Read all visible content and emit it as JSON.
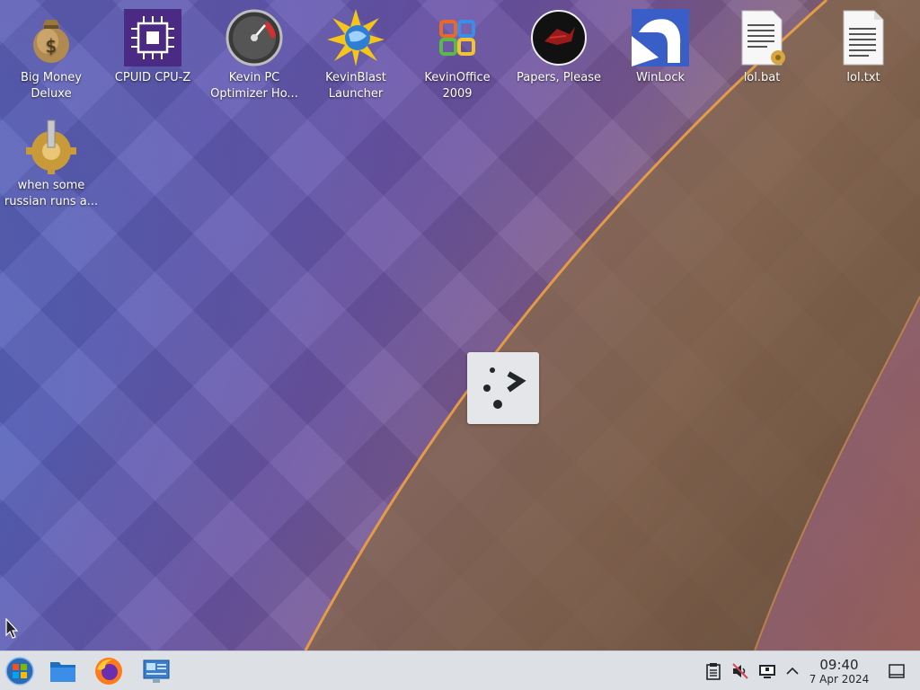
{
  "desktop": {
    "icons": [
      {
        "label": "Big Money Deluxe",
        "icon": "money-bag-icon"
      },
      {
        "label": "CPUID CPU-Z",
        "icon": "cpu-chip-icon"
      },
      {
        "label": "Kevin PC Optimizer Ho...",
        "icon": "speedometer-icon"
      },
      {
        "label": "KevinBlast Launcher",
        "icon": "starburst-globe-icon"
      },
      {
        "label": "KevinOffice 2009",
        "icon": "office-logo-icon"
      },
      {
        "label": "Papers, Please",
        "icon": "papers-please-icon"
      },
      {
        "label": "WinLock",
        "icon": "winlock-icon"
      },
      {
        "label": "lol.bat",
        "icon": "batch-file-icon"
      },
      {
        "label": "lol.txt",
        "icon": "text-file-icon"
      },
      {
        "label": "when some russian runs a...",
        "icon": "gear-joystick-icon"
      }
    ]
  },
  "busy_indicator": {
    "icon": "launch-feedback-icon"
  },
  "taskbar": {
    "pinned": [
      {
        "name": "start-menu",
        "icon": "windows-orb-icon"
      },
      {
        "name": "file-manager",
        "icon": "folder-icon"
      },
      {
        "name": "firefox",
        "icon": "firefox-icon"
      },
      {
        "name": "remote-desktop",
        "icon": "remote-desktop-icon"
      }
    ],
    "tray": [
      {
        "name": "clipboard",
        "icon": "clipboard-icon"
      },
      {
        "name": "volume-muted",
        "icon": "speaker-muted-icon"
      },
      {
        "name": "display",
        "icon": "monitor-icon"
      },
      {
        "name": "expand-tray",
        "icon": "chevron-up-icon"
      }
    ],
    "clock": {
      "time": "09:40",
      "date": "7 Apr 2024"
    },
    "show_desktop_icon": "show-desktop-icon"
  },
  "colors": {
    "taskbar": "#dde1e6",
    "accent_orange": "#f4a640"
  }
}
